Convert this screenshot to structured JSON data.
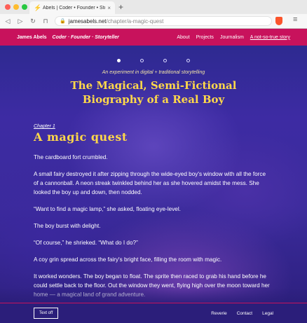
{
  "browser": {
    "tab_title": "Abels | Coder • Founder • Storyt",
    "tab_close": "×",
    "new_tab": "+",
    "url_host": "jamesabels.net",
    "url_path": "/chapter/a-magic-quest",
    "lock": "🔒",
    "back": "◁",
    "forward": "▷",
    "reload": "↻",
    "bookmark": "⊓",
    "menu": "≡"
  },
  "header": {
    "brand": "James Abels",
    "tagline": "Coder · Founder · Storyteller",
    "nav": [
      "About",
      "Projects",
      "Journalism",
      "A not-so-true story"
    ]
  },
  "kicker": "An experiment in digital + traditional storytelling",
  "title": "The Magical, Semi-Fictional Biography of a Real Boy",
  "chapter": {
    "label": "Chapter 1",
    "title": "A magic quest"
  },
  "story": [
    "The cardboard fort crumbled.",
    "A small fairy destroyed it after zipping through the wide-eyed boy's window with all the force of a cannonball. A neon streak twinkled behind her as she hovered amidst the mess. She looked the boy up and down, then nodded.",
    "“Want to find a magic lamp,” she asked, floating eye-level.",
    "The boy burst with delight.",
    "“Of course,” he shrieked. “What do I do?”",
    "A coy grin spread across the fairy's bright face, filling the room with magic.",
    "It worked wonders. The boy began to float. The sprite then raced to grab his hand before he could settle back to the floor. Out the window they went, flying high over the moon toward her home — a magical land of grand adventure."
  ],
  "footer": {
    "text_off": "Text off",
    "links": [
      "Reverie",
      "Contact",
      "Legal"
    ]
  },
  "colors": {
    "accent": "#c8125c",
    "headline": "#ffd84a",
    "background": "#3b2b9c"
  }
}
